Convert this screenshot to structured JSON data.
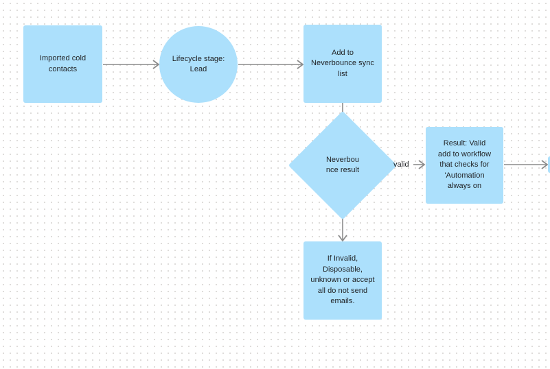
{
  "diagram": {
    "type": "flowchart",
    "background": "#ffffff",
    "grid": "dot-grid",
    "node_fill": "#ace0fc",
    "edge_color": "#8c8c8c",
    "text_color": "#1f2023",
    "nodes": [
      {
        "id": "imported-cold-contacts",
        "shape": "rectangle",
        "label": "Imported cold\ncontacts"
      },
      {
        "id": "lifecycle-stage-lead",
        "shape": "circle",
        "label": "Lifecycle stage:\nLead"
      },
      {
        "id": "add-to-neverbounce-sync-list",
        "shape": "rectangle",
        "label": "Add to\nNeverbounce sync\nlist"
      },
      {
        "id": "neverbounce-result",
        "shape": "diamond",
        "label": "Neverbou\nnce result"
      },
      {
        "id": "result-valid-add-to-workflow",
        "shape": "rectangle",
        "label": "Result: Valid\nadd to workflow\nthat checks for\n'Automation\nalways on"
      },
      {
        "id": "if-invalid-do-not-send",
        "shape": "rectangle",
        "label": "If Invalid,\nDisposable,\nunknown or accept\nall do not send\nemails."
      },
      {
        "id": "offscreen-node",
        "shape": "rectangle",
        "label": ""
      }
    ],
    "edges": [
      {
        "id": "edge-contacts-to-lifecycle",
        "from": "imported-cold-contacts",
        "to": "lifecycle-stage-lead",
        "label": ""
      },
      {
        "id": "edge-lifecycle-to-sync-list",
        "from": "lifecycle-stage-lead",
        "to": "add-to-neverbounce-sync-list",
        "label": ""
      },
      {
        "id": "edge-sync-list-to-result",
        "from": "add-to-neverbounce-sync-list",
        "to": "neverbounce-result",
        "label": ""
      },
      {
        "id": "edge-result-to-valid",
        "from": "neverbounce-result",
        "to": "result-valid-add-to-workflow",
        "label": "valid"
      },
      {
        "id": "edge-result-to-invalid",
        "from": "neverbounce-result",
        "to": "if-invalid-do-not-send",
        "label": ""
      },
      {
        "id": "edge-valid-to-offscreen",
        "from": "result-valid-add-to-workflow",
        "to": "offscreen-node",
        "label": ""
      }
    ]
  }
}
